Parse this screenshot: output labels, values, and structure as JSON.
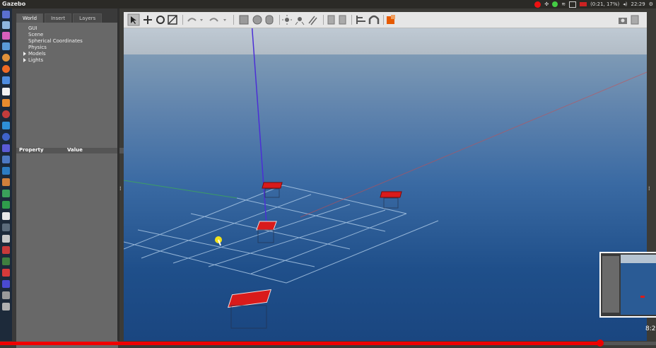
{
  "app": {
    "title": "Gazebo"
  },
  "tray": {
    "battery": "(0:21, 17%)",
    "clock": "22:29"
  },
  "tabs": [
    {
      "label": "World"
    },
    {
      "label": "Insert"
    },
    {
      "label": "Layers"
    }
  ],
  "tree": [
    {
      "label": "GUI",
      "expandable": false
    },
    {
      "label": "Scene",
      "expandable": false
    },
    {
      "label": "Spherical Coordinates",
      "expandable": false
    },
    {
      "label": "Physics",
      "expandable": false
    },
    {
      "label": "Models",
      "expandable": true
    },
    {
      "label": "Lights",
      "expandable": true
    }
  ],
  "properties": {
    "col_property": "Property",
    "col_value": "Value"
  },
  "video": {
    "time": "8:2",
    "progress": 0.915
  },
  "toolbar_icons": [
    "select-arrow-icon",
    "translate-icon",
    "rotate-icon",
    "scale-icon",
    "undo-icon",
    "undo-dropdown-icon",
    "redo-icon",
    "redo-dropdown-icon",
    "box-shape-icon",
    "sphere-shape-icon",
    "cylinder-shape-icon",
    "point-light-icon",
    "spot-light-icon",
    "directional-light-icon",
    "copy-icon",
    "paste-icon",
    "align-icon",
    "snap-magnet-icon",
    "change-view-icon",
    "screenshot-camera-icon",
    "record-icon"
  ],
  "colors": {
    "accent": "#e65a00",
    "progress": "#e00000",
    "launcher": "#1d2a3a"
  }
}
